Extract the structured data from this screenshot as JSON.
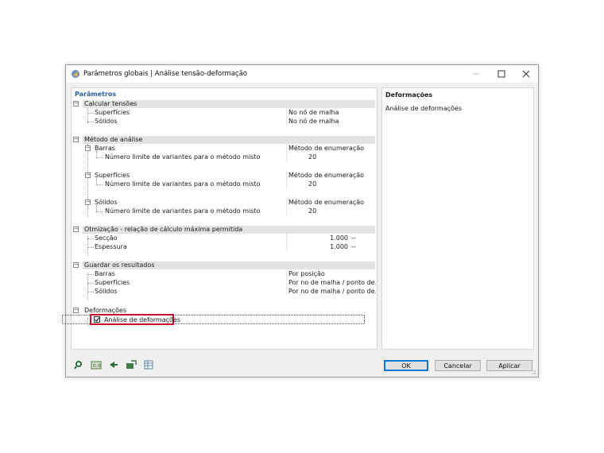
{
  "window": {
    "title": "Parâmetros globais | Análise tensão-deformação"
  },
  "left_panel": {
    "title": "Parâmetros",
    "sections": {
      "calc": {
        "label": "Calcular tensões",
        "surfaces": {
          "label": "Superfícies",
          "value": "No nó de malha"
        },
        "solids": {
          "label": "Sólidos",
          "value": "No nó de malha"
        }
      },
      "method": {
        "label": "Método de análise",
        "bars": {
          "label": "Barras",
          "value": "Método de enumeração",
          "limit_label": "Número limite de variantes para o método misto",
          "limit_value": "20"
        },
        "surfaces": {
          "label": "Superfícies",
          "value": "Método de enumeração",
          "limit_label": "Número limite de variantes para o método misto",
          "limit_value": "20"
        },
        "solids": {
          "label": "Sólidos",
          "value": "Método de enumeração",
          "limit_label": "Número limite de variantes para o método misto",
          "limit_value": "20"
        }
      },
      "optim": {
        "label": "Otmização - relação de cálculo máxima permitida",
        "section": {
          "label": "Secção",
          "value": "1.000",
          "unit": "--"
        },
        "thickness": {
          "label": "Espessura",
          "value": "1.000",
          "unit": "--"
        }
      },
      "save": {
        "label": "Guardar os resultados",
        "bars": {
          "label": "Barras",
          "value": "Por posição"
        },
        "surfaces": {
          "label": "Superfícies",
          "value": "Por no de malha / ponto de..."
        },
        "solids": {
          "label": "Sólidos",
          "value": "Por no de malha / ponto de..."
        }
      },
      "deform": {
        "label": "Deformações",
        "analysis": {
          "label": "Análise de deformações",
          "checked": true
        }
      }
    }
  },
  "right_panel": {
    "title": "Deformações",
    "description": "Análise de deformações"
  },
  "buttons": {
    "ok": "OK",
    "cancel": "Cancelar",
    "apply": "Aplicar"
  },
  "bottom_icons": [
    "search-icon",
    "units-icon",
    "arrow-icon",
    "export-icon",
    "table-icon"
  ],
  "colors": {
    "accent": "#0078d7",
    "highlight": "#c8102e",
    "header_bg": "#e3e3e3",
    "title_blue": "#2b5fa8"
  }
}
